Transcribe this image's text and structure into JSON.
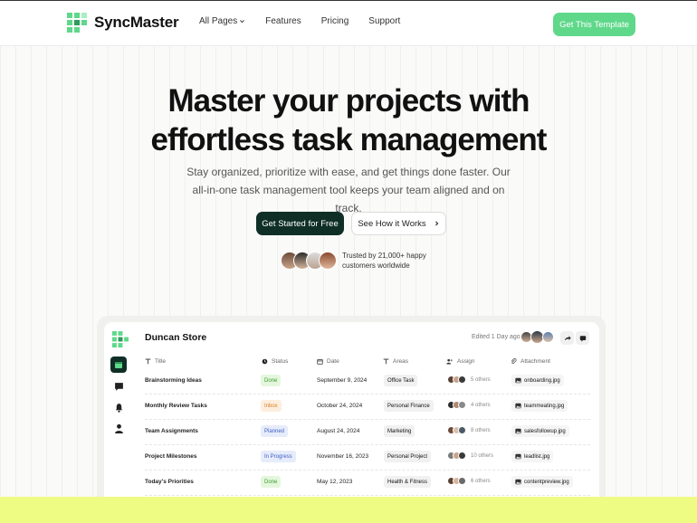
{
  "brand": {
    "name": "SyncMaster",
    "accent": "#5fd88a",
    "dark": "#0f2f26"
  },
  "nav": {
    "items": [
      {
        "label": "All Pages",
        "icon": "chevron-down-icon"
      },
      {
        "label": "Features"
      },
      {
        "label": "Pricing"
      },
      {
        "label": "Support"
      }
    ],
    "cta": "Get This Template"
  },
  "hero": {
    "title_line1": "Master your projects with",
    "title_line2": "effortless task management",
    "subtitle": "Stay organized, prioritize with ease, and get things done faster. Our all-in-one task management tool keeps your team aligned and on track.",
    "primary_button": "Get Started for Free",
    "secondary_button": "See How it Works",
    "trusted_line1": "Trusted by 21,000+ happy",
    "trusted_line2": "customers worldwide"
  },
  "app": {
    "store_name": "Duncan Store",
    "edited": "Edited 1 Day ago",
    "columns": [
      "Title",
      "Status",
      "Date",
      "Areas",
      "Assign",
      "Attachment"
    ],
    "rows": [
      {
        "title": "Brainstorming Ideas",
        "status": "Done",
        "date": "September 9, 2024",
        "area": "Office Task",
        "others": "5 others",
        "file": "onboarding.jpg"
      },
      {
        "title": "Monthly Review Tasks",
        "status": "Inbox",
        "date": "October 24, 2024",
        "area": "Personal Finance",
        "others": "4 others",
        "file": "teammeating.jpg"
      },
      {
        "title": "Team Assignments",
        "status": "Planned",
        "date": "August 24, 2024",
        "area": "Marketing",
        "others": "8 others",
        "file": "salesfollowup.jpg"
      },
      {
        "title": "Project Milestones",
        "status": "In Progress",
        "date": "November 16, 2023",
        "area": "Personal Project",
        "others": "10 others",
        "file": "leadlist.jpg"
      },
      {
        "title": "Today's Priorities",
        "status": "Done",
        "date": "May 12, 2023",
        "area": "Health & Fitness",
        "others": "6 others",
        "file": "contentpreview.jpg"
      }
    ],
    "status_colors": {
      "Done": {
        "bg": "#e4f7dd",
        "fg": "#3c9a2e"
      },
      "Inbox": {
        "bg": "#fdeede",
        "fg": "#d9822b"
      },
      "Planned": {
        "bg": "#e6ecfb",
        "fg": "#3d5fc4"
      },
      "In Progress": {
        "bg": "#e6ecfb",
        "fg": "#3d5fc4"
      }
    }
  }
}
